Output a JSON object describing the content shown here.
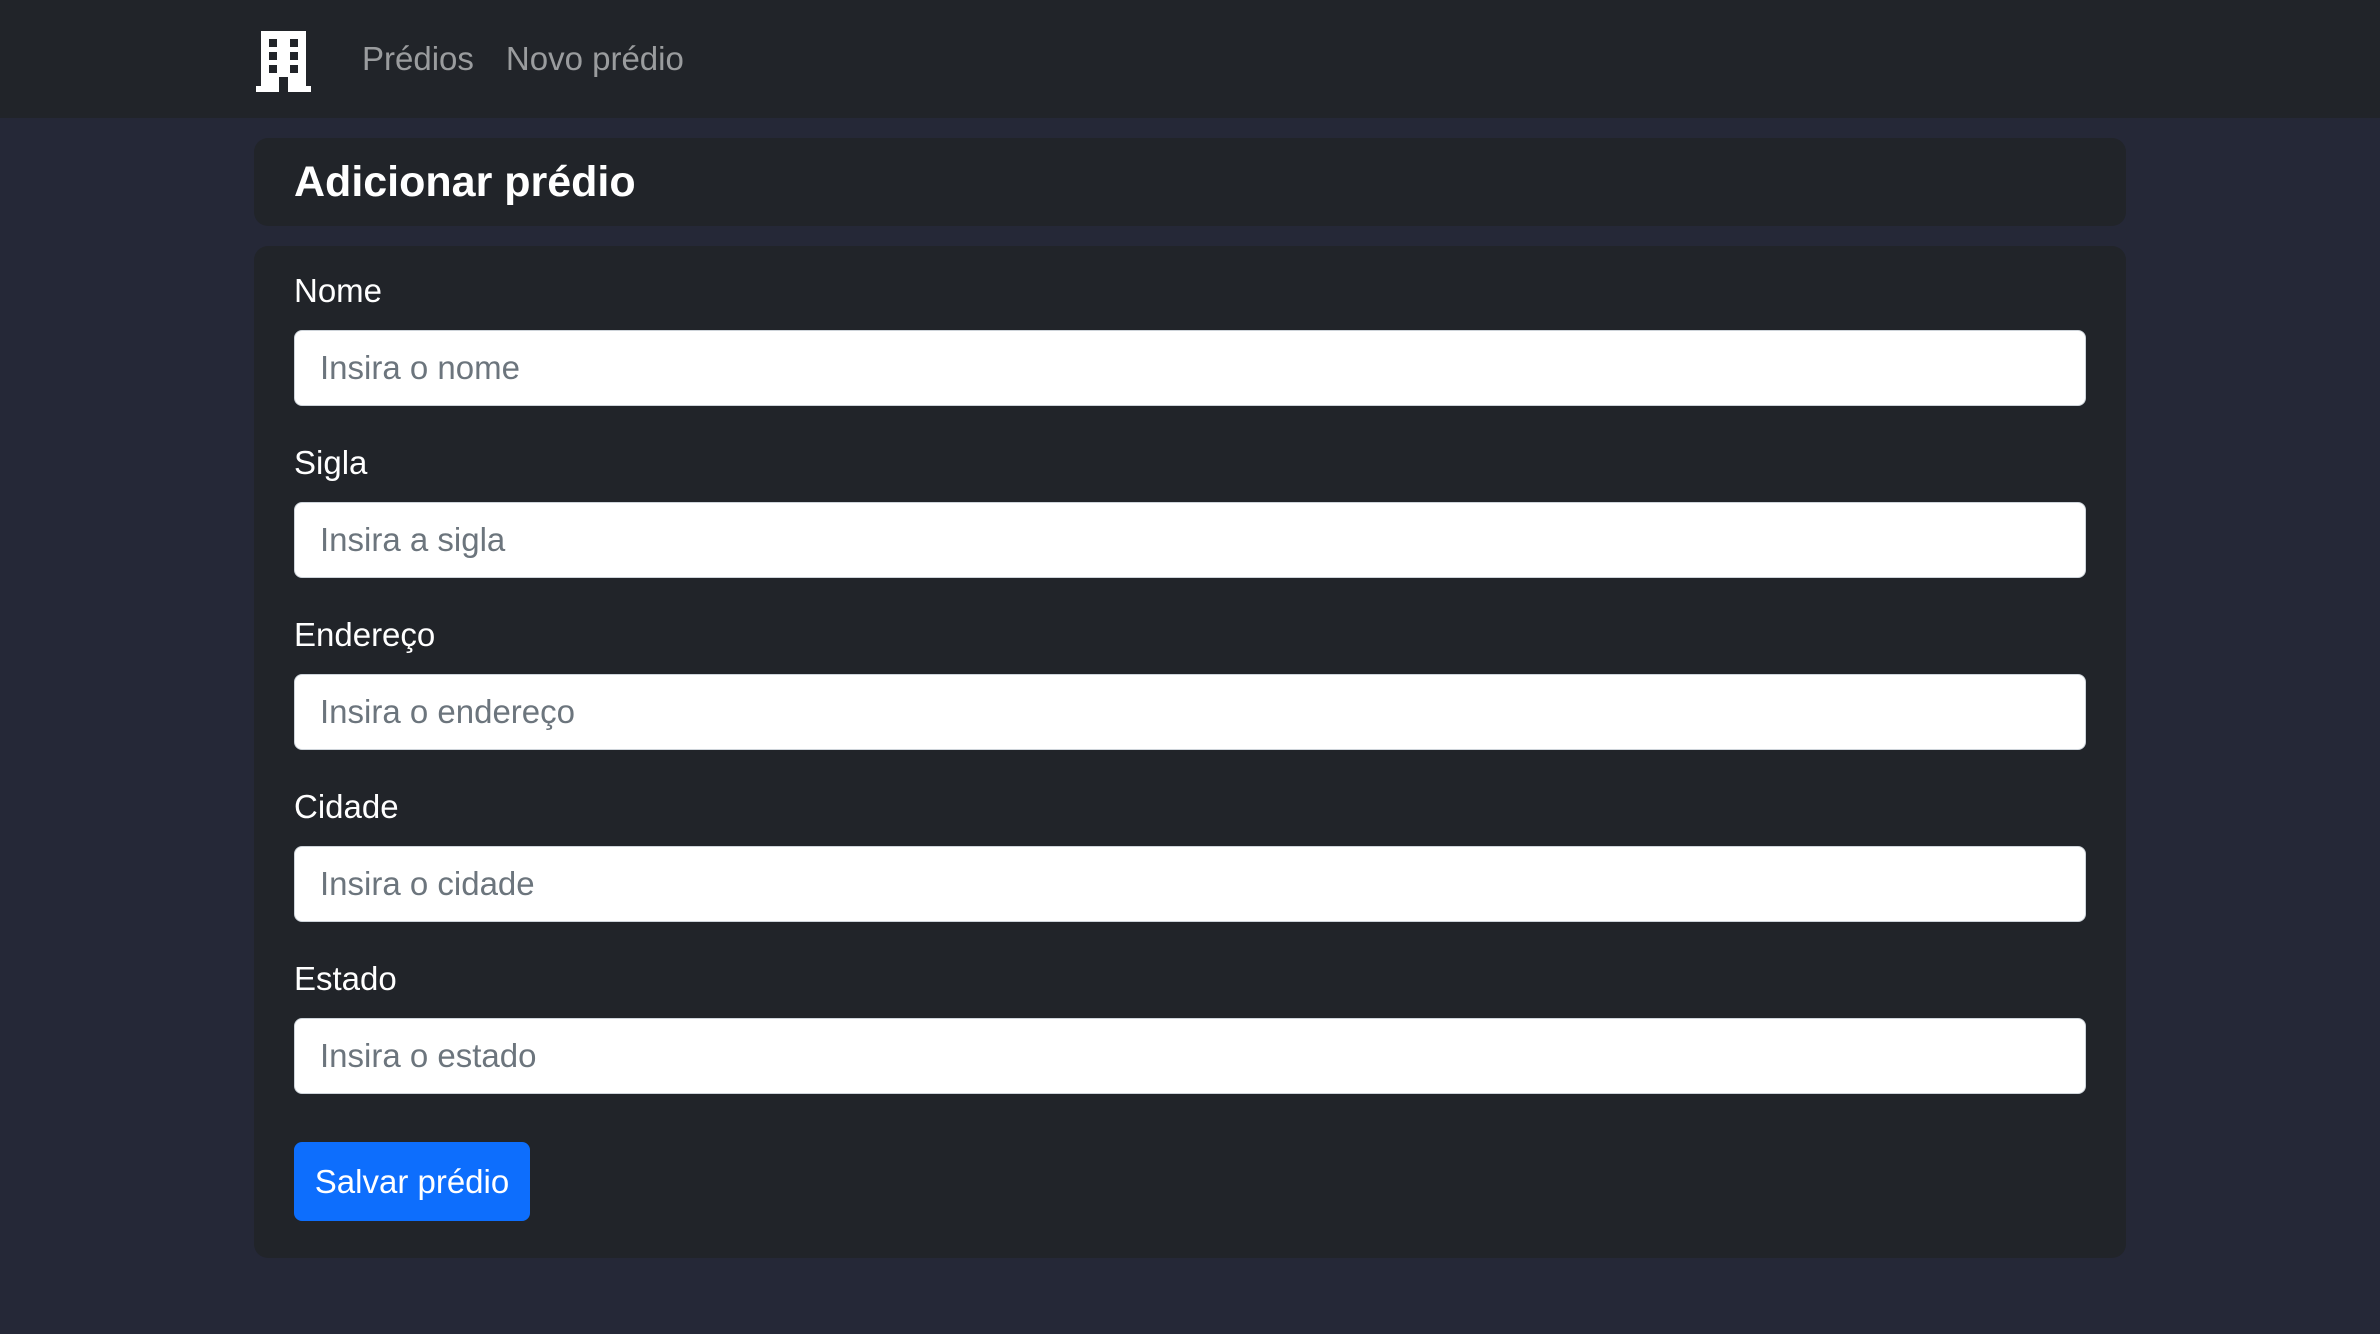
{
  "navbar": {
    "brand_icon": "building-icon",
    "links": [
      {
        "label": "Prédios"
      },
      {
        "label": "Novo prédio"
      }
    ]
  },
  "page": {
    "title": "Adicionar prédio"
  },
  "form": {
    "fields": [
      {
        "label": "Nome",
        "placeholder": "Insira o nome",
        "value": ""
      },
      {
        "label": "Sigla",
        "placeholder": "Insira a sigla",
        "value": ""
      },
      {
        "label": "Endereço",
        "placeholder": "Insira o endereço",
        "value": ""
      },
      {
        "label": "Cidade",
        "placeholder": "Insira o cidade",
        "value": ""
      },
      {
        "label": "Estado",
        "placeholder": "Insira o estado",
        "value": ""
      }
    ],
    "submit_label": "Salvar prédio"
  },
  "colors": {
    "page_background": "#252837",
    "card_background": "#212429",
    "primary_button": "#0d6efd"
  }
}
